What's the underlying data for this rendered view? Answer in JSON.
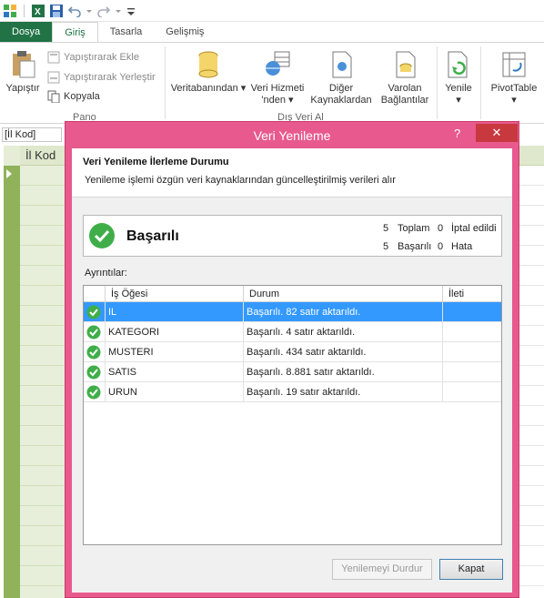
{
  "tabs": {
    "file": "Dosya",
    "home": "Giriş",
    "design": "Tasarla",
    "advanced": "Gelişmiş"
  },
  "ribbon": {
    "paste": "Yapıştır",
    "paste_append": "Yapıştırarak Ekle",
    "paste_replace": "Yapıştırarak Yerleştir",
    "copy": "Kopyala",
    "clipboard_group": "Pano",
    "from_database": "Veritabanından",
    "from_data_service_1": "Veri Hizmeti",
    "from_data_service_2": "'nden",
    "other_sources_1": "Diğer",
    "other_sources_2": "Kaynaklardan",
    "existing_connections_1": "Varolan",
    "existing_connections_2": "Bağlantılar",
    "get_external_group": "Dış Veri Al",
    "refresh": "Yenile",
    "pivottable": "PivotTable"
  },
  "namebox": "[İl Kod]",
  "column_header": "İl Kod",
  "dialog": {
    "title": "Veri Yenileme",
    "help": "?",
    "header_title": "Veri Yenileme İlerleme Durumu",
    "header_desc": "Yenileme işlemi özgün veri kaynaklarından güncelleştirilmiş verileri alır",
    "status": "Başarılı",
    "stats": {
      "total_value": "5",
      "total_label": "Toplam",
      "cancelled_value": "0",
      "cancelled_label": "İptal edildi",
      "success_value": "5",
      "success_label": "Başarılı",
      "error_value": "0",
      "error_label": "Hata"
    },
    "details_label": "Ayrıntılar:",
    "columns": [
      "İş Öğesi",
      "Durum",
      "İleti"
    ],
    "rows": [
      {
        "item": "IL",
        "status": "Başarılı. 82 satır aktarıldı.",
        "message": ""
      },
      {
        "item": "KATEGORI",
        "status": "Başarılı. 4 satır aktarıldı.",
        "message": ""
      },
      {
        "item": "MUSTERI",
        "status": "Başarılı. 434 satır aktarıldı.",
        "message": ""
      },
      {
        "item": "SATIS",
        "status": "Başarılı. 8.881 satır aktarıldı.",
        "message": ""
      },
      {
        "item": "URUN",
        "status": "Başarılı. 19 satır aktarıldı.",
        "message": ""
      }
    ],
    "stop_button": "Yenilemeyi Durdur",
    "close_button": "Kapat"
  },
  "colors": {
    "excel_green": "#217346",
    "dialog_border": "#e8598d",
    "selection": "#3399ff",
    "success": "#3fae49"
  }
}
